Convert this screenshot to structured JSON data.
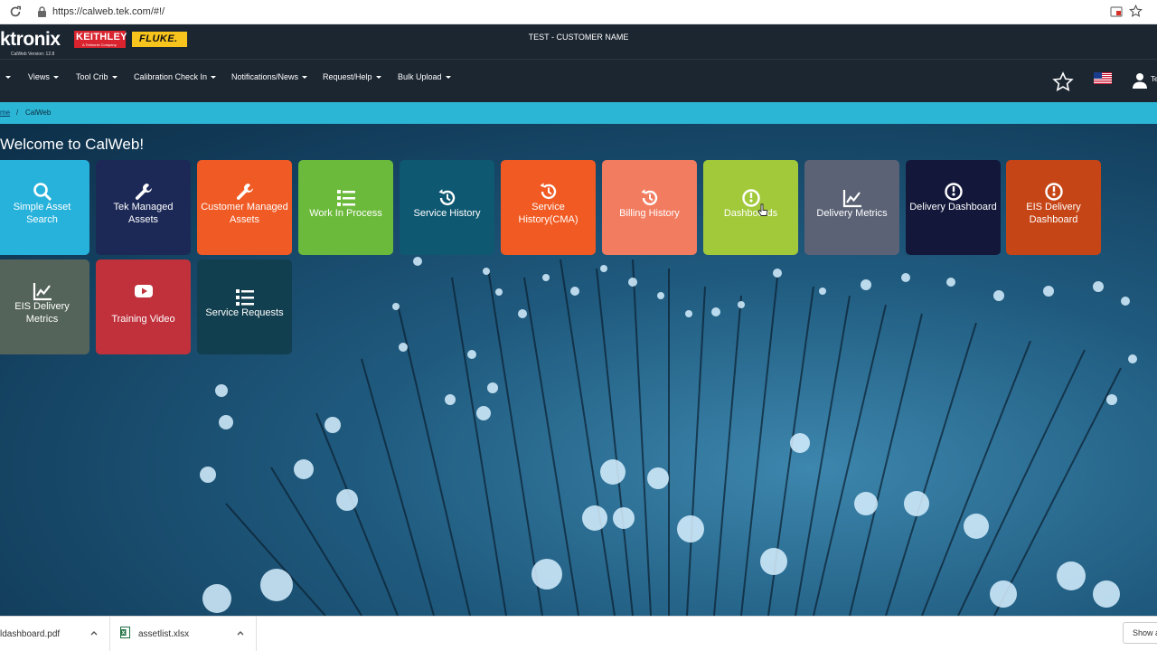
{
  "browser": {
    "url": "https://calweb.tek.com/#!/"
  },
  "header": {
    "logo_text": "ktronix",
    "version": "CalWeb Version: 12.8",
    "keithley": "KEITHLEY",
    "keithley_sub": "A Tektronix Company",
    "fluke": "FLUKE.",
    "customer": "TEST - CUSTOMER NAME"
  },
  "nav": {
    "items": [
      "Views",
      "Tool Crib",
      "Calibration Check In",
      "Notifications/News",
      "Request/Help",
      "Bulk Upload"
    ],
    "user_partial": "Te"
  },
  "breadcrumb": {
    "home": "me",
    "separator": "/",
    "current": "CalWeb"
  },
  "main": {
    "welcome": "Welcome to CalWeb!",
    "tiles": [
      {
        "label": "Simple Asset Search",
        "icon": "search-icon",
        "color": "#27b2dc"
      },
      {
        "label": "Tek Managed Assets",
        "icon": "wrench-icon",
        "color": "#1c2957"
      },
      {
        "label": "Customer Managed Assets",
        "icon": "wrench-icon",
        "color": "#f05a24"
      },
      {
        "label": "Work In Process",
        "icon": "list-icon",
        "color": "#6cba3c"
      },
      {
        "label": "Service History",
        "icon": "history-icon",
        "color": "#0f5871"
      },
      {
        "label": "Service History(CMA)",
        "icon": "history-icon",
        "color": "#f15a22"
      },
      {
        "label": "Billing History",
        "icon": "history-icon",
        "color": "#f27c60"
      },
      {
        "label": "Dashboards",
        "icon": "dashboard-icon",
        "color": "#a2c93a"
      },
      {
        "label": "Delivery Metrics",
        "icon": "chart-icon",
        "color": "#5b6275"
      },
      {
        "label": "Delivery Dashboard",
        "icon": "dashboard-icon",
        "color": "#13183a"
      },
      {
        "label": "EIS Delivery Dashboard",
        "icon": "dashboard-icon",
        "color": "#c64516"
      },
      {
        "label": "EIS Delivery Metrics",
        "icon": "chart-icon",
        "color": "#55645a"
      },
      {
        "label": "Training Video",
        "icon": "youtube-icon",
        "color": "#c0313c"
      },
      {
        "label": "Service Requests",
        "icon": "list-icon",
        "color": "#123f4f"
      }
    ]
  },
  "downloads": {
    "items": [
      "ldashboard.pdf",
      "assetlist.xlsx"
    ],
    "show_all": "Show a"
  }
}
